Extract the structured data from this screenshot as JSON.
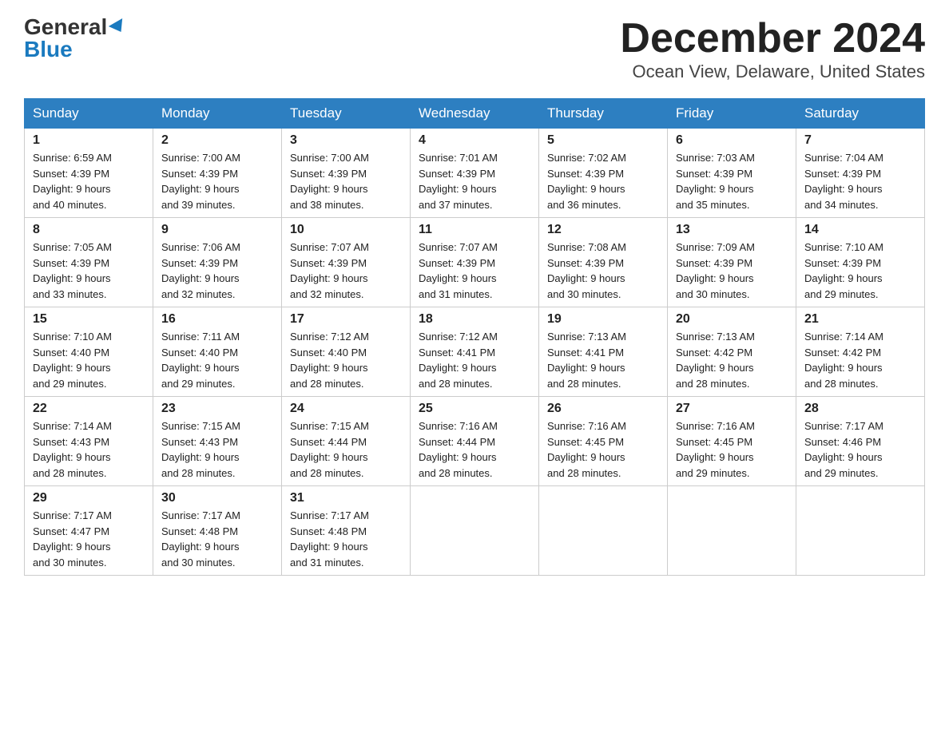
{
  "header": {
    "logo_general": "General",
    "logo_blue": "Blue",
    "month_year": "December 2024",
    "location": "Ocean View, Delaware, United States"
  },
  "days_of_week": [
    "Sunday",
    "Monday",
    "Tuesday",
    "Wednesday",
    "Thursday",
    "Friday",
    "Saturday"
  ],
  "weeks": [
    [
      {
        "day": "1",
        "sunrise": "6:59 AM",
        "sunset": "4:39 PM",
        "daylight": "9 hours and 40 minutes."
      },
      {
        "day": "2",
        "sunrise": "7:00 AM",
        "sunset": "4:39 PM",
        "daylight": "9 hours and 39 minutes."
      },
      {
        "day": "3",
        "sunrise": "7:00 AM",
        "sunset": "4:39 PM",
        "daylight": "9 hours and 38 minutes."
      },
      {
        "day": "4",
        "sunrise": "7:01 AM",
        "sunset": "4:39 PM",
        "daylight": "9 hours and 37 minutes."
      },
      {
        "day": "5",
        "sunrise": "7:02 AM",
        "sunset": "4:39 PM",
        "daylight": "9 hours and 36 minutes."
      },
      {
        "day": "6",
        "sunrise": "7:03 AM",
        "sunset": "4:39 PM",
        "daylight": "9 hours and 35 minutes."
      },
      {
        "day": "7",
        "sunrise": "7:04 AM",
        "sunset": "4:39 PM",
        "daylight": "9 hours and 34 minutes."
      }
    ],
    [
      {
        "day": "8",
        "sunrise": "7:05 AM",
        "sunset": "4:39 PM",
        "daylight": "9 hours and 33 minutes."
      },
      {
        "day": "9",
        "sunrise": "7:06 AM",
        "sunset": "4:39 PM",
        "daylight": "9 hours and 32 minutes."
      },
      {
        "day": "10",
        "sunrise": "7:07 AM",
        "sunset": "4:39 PM",
        "daylight": "9 hours and 32 minutes."
      },
      {
        "day": "11",
        "sunrise": "7:07 AM",
        "sunset": "4:39 PM",
        "daylight": "9 hours and 31 minutes."
      },
      {
        "day": "12",
        "sunrise": "7:08 AM",
        "sunset": "4:39 PM",
        "daylight": "9 hours and 30 minutes."
      },
      {
        "day": "13",
        "sunrise": "7:09 AM",
        "sunset": "4:39 PM",
        "daylight": "9 hours and 30 minutes."
      },
      {
        "day": "14",
        "sunrise": "7:10 AM",
        "sunset": "4:39 PM",
        "daylight": "9 hours and 29 minutes."
      }
    ],
    [
      {
        "day": "15",
        "sunrise": "7:10 AM",
        "sunset": "4:40 PM",
        "daylight": "9 hours and 29 minutes."
      },
      {
        "day": "16",
        "sunrise": "7:11 AM",
        "sunset": "4:40 PM",
        "daylight": "9 hours and 29 minutes."
      },
      {
        "day": "17",
        "sunrise": "7:12 AM",
        "sunset": "4:40 PM",
        "daylight": "9 hours and 28 minutes."
      },
      {
        "day": "18",
        "sunrise": "7:12 AM",
        "sunset": "4:41 PM",
        "daylight": "9 hours and 28 minutes."
      },
      {
        "day": "19",
        "sunrise": "7:13 AM",
        "sunset": "4:41 PM",
        "daylight": "9 hours and 28 minutes."
      },
      {
        "day": "20",
        "sunrise": "7:13 AM",
        "sunset": "4:42 PM",
        "daylight": "9 hours and 28 minutes."
      },
      {
        "day": "21",
        "sunrise": "7:14 AM",
        "sunset": "4:42 PM",
        "daylight": "9 hours and 28 minutes."
      }
    ],
    [
      {
        "day": "22",
        "sunrise": "7:14 AM",
        "sunset": "4:43 PM",
        "daylight": "9 hours and 28 minutes."
      },
      {
        "day": "23",
        "sunrise": "7:15 AM",
        "sunset": "4:43 PM",
        "daylight": "9 hours and 28 minutes."
      },
      {
        "day": "24",
        "sunrise": "7:15 AM",
        "sunset": "4:44 PM",
        "daylight": "9 hours and 28 minutes."
      },
      {
        "day": "25",
        "sunrise": "7:16 AM",
        "sunset": "4:44 PM",
        "daylight": "9 hours and 28 minutes."
      },
      {
        "day": "26",
        "sunrise": "7:16 AM",
        "sunset": "4:45 PM",
        "daylight": "9 hours and 28 minutes."
      },
      {
        "day": "27",
        "sunrise": "7:16 AM",
        "sunset": "4:45 PM",
        "daylight": "9 hours and 29 minutes."
      },
      {
        "day": "28",
        "sunrise": "7:17 AM",
        "sunset": "4:46 PM",
        "daylight": "9 hours and 29 minutes."
      }
    ],
    [
      {
        "day": "29",
        "sunrise": "7:17 AM",
        "sunset": "4:47 PM",
        "daylight": "9 hours and 30 minutes."
      },
      {
        "day": "30",
        "sunrise": "7:17 AM",
        "sunset": "4:48 PM",
        "daylight": "9 hours and 30 minutes."
      },
      {
        "day": "31",
        "sunrise": "7:17 AM",
        "sunset": "4:48 PM",
        "daylight": "9 hours and 31 minutes."
      },
      null,
      null,
      null,
      null
    ]
  ],
  "labels": {
    "sunrise": "Sunrise:",
    "sunset": "Sunset:",
    "daylight": "Daylight:"
  }
}
